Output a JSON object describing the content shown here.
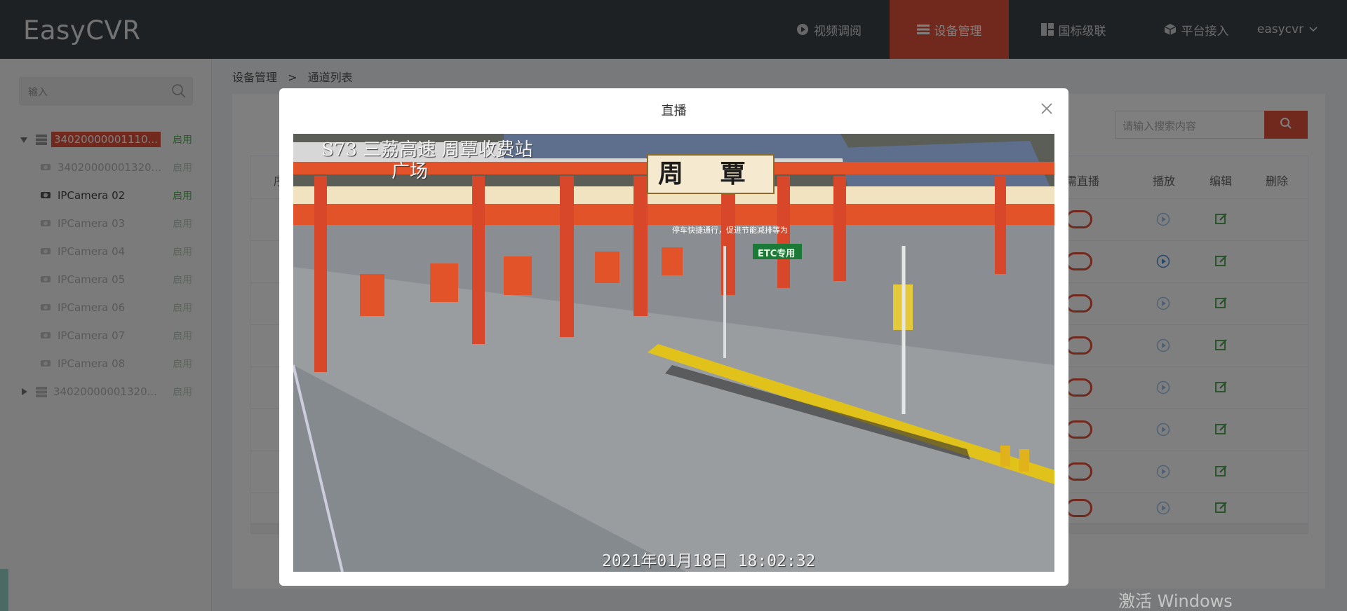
{
  "app": {
    "title": "EasyCVR"
  },
  "nav": [
    {
      "label": "视频调阅",
      "icon": "play-circle-icon",
      "active": false
    },
    {
      "label": "设备管理",
      "icon": "list-icon",
      "active": true
    },
    {
      "label": "国标级联",
      "icon": "cascade-icon",
      "active": false
    },
    {
      "label": "平台接入",
      "icon": "cube-icon",
      "active": false
    }
  ],
  "user": {
    "name": "easycvr"
  },
  "sidebar": {
    "search_placeholder": "输入",
    "tree": [
      {
        "label": "34020000001110...",
        "status": "启用",
        "type": "device",
        "selected": true,
        "expanded": true
      },
      {
        "label": "34020000001320...",
        "status": "启用",
        "type": "camera",
        "selected": false
      },
      {
        "label": "IPCamera 02",
        "status": "启用",
        "type": "camera",
        "selected": false
      },
      {
        "label": "IPCamera 03",
        "status": "启用",
        "type": "camera",
        "selected": false
      },
      {
        "label": "IPCamera 04",
        "status": "启用",
        "type": "camera",
        "selected": false
      },
      {
        "label": "IPCamera 05",
        "status": "启用",
        "type": "camera",
        "selected": false
      },
      {
        "label": "IPCamera 06",
        "status": "启用",
        "type": "camera",
        "selected": false
      },
      {
        "label": "IPCamera 07",
        "status": "启用",
        "type": "camera",
        "selected": false
      },
      {
        "label": "IPCamera 08",
        "status": "启用",
        "type": "camera",
        "selected": false
      },
      {
        "label": "34020000001320...",
        "status": "启用",
        "type": "device",
        "selected": false,
        "expanded": false
      }
    ]
  },
  "breadcrumb": {
    "root": "设备管理",
    "separator": ">",
    "current": "通道列表"
  },
  "table_search": {
    "placeholder": "请输入搜索内容"
  },
  "table": {
    "headers": [
      "序",
      "需直播",
      "播放",
      "编辑",
      "删除"
    ],
    "row_count": 8
  },
  "modal": {
    "title": "直播",
    "osd_top": "S73 三荔高速 周覃收费站",
    "osd_top_line2": "广场",
    "osd_time": "2021年01月18日  18:02:32",
    "scene_signs": {
      "plaza_name": "周 覃",
      "etc_lane": "ETC专用",
      "banner": "停车快捷通行，促进节能减排等为"
    }
  },
  "os_watermark": "激活 Windows",
  "colors": {
    "accent": "#e2533a",
    "header_bg": "#3d4248",
    "enabled_green": "#5cae5c",
    "edit_green": "#43a047",
    "play_blue": "#4a90d9"
  }
}
